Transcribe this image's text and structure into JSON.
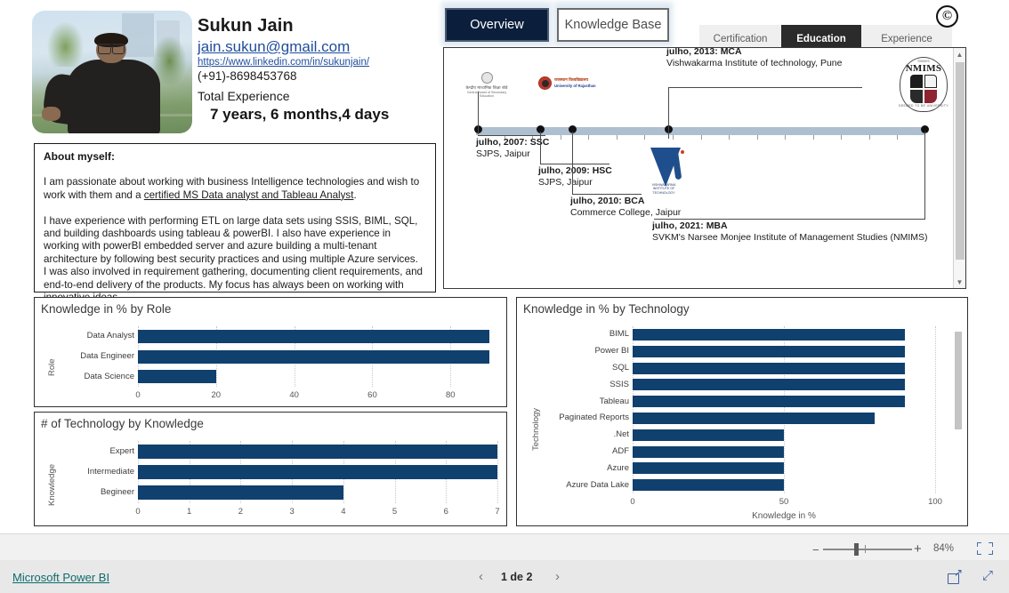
{
  "profile": {
    "name": "Sukun Jain",
    "email": "jain.sukun@gmail.com",
    "linkedin": "https://www.linkedin.com/in/sukunjain/",
    "phone": "(+91)-8698453768",
    "experience_label": "Total Experience",
    "experience_value": "7 years, 6 months,4 days",
    "photo_alt": "profile-photo"
  },
  "about": {
    "title": "About myself:",
    "line1": "I am passionate about working with business Intelligence technologies and wish to work with them and a ",
    "link": "certified MS Data analyst and Tableau Analyst",
    "line1_end": ".",
    "body_rest": "I have experience with performing ETL on large data sets using SSIS, BIML, SQL, and building dashboards using tableau & powerBI. I also have experience in working with powerBI embedded server and azure building a multi-tenant architecture by following best security practices and using multiple Azure services.\nI was also involved in requirement gathering, documenting client requirements, and end-to-end delivery of the products. My focus has always been on working with innovative ideas."
  },
  "main_tabs": [
    {
      "label": "Overview",
      "active": true
    },
    {
      "label": "Knowledge Base",
      "active": false
    }
  ],
  "sub_tabs": [
    {
      "label": "Certification",
      "active": false
    },
    {
      "label": "Education",
      "active": true
    },
    {
      "label": "Experience",
      "active": false
    }
  ],
  "copyright_symbol": "©",
  "timeline": {
    "logos": [
      {
        "name": "cbse-logo",
        "line1": "केन्द्रीय माध्यमिक शिक्षा बोर्ड",
        "line2": "Central Board of Secondary Education"
      },
      {
        "name": "university-of-rajasthan-logo",
        "line1": "राजस्थान विश्वविद्यालय",
        "line2": "University of Rajasthan"
      },
      {
        "name": "vishwakarma-institute-logo",
        "caption": "VISHWAKARMA INSTITUTE OF TECHNOLOGY"
      },
      {
        "name": "nmims-logo",
        "top": "SVKM'S",
        "title": "NMIMS",
        "arc": "DEEMED TO BE UNIVERSITY"
      }
    ],
    "events": [
      {
        "date": "julho, 2007:",
        "degree": "SSC",
        "institute": "SJPS, Jaipur"
      },
      {
        "date": "julho, 2009:",
        "degree": "HSC",
        "institute": "SJPS, Jaipur"
      },
      {
        "date": "julho, 2010:",
        "degree": "BCA",
        "institute": "Commerce College, Jaipur"
      },
      {
        "date": "julho, 2013:",
        "degree": "MCA",
        "institute": "Vishwakarma Institute of technology, Pune"
      },
      {
        "date": "julho, 2021:",
        "degree": "MBA",
        "institute": "SVKM's Narsee Monjee Institute of Management Studies (NMIMS)"
      }
    ]
  },
  "chart_data": [
    {
      "id": "knowledge-by-role",
      "type": "bar",
      "orientation": "horizontal",
      "title": "Knowledge in % by Role",
      "categories": [
        "Data Analyst",
        "Data Engineer",
        "Data Science"
      ],
      "values": [
        90,
        90,
        20
      ],
      "xlabel": "",
      "ylabel": "Role",
      "xlim": [
        0,
        92
      ],
      "xticks": [
        0,
        20,
        40,
        60,
        80
      ],
      "grid": true,
      "bar_color": "#10406e"
    },
    {
      "id": "technology-count-by-knowledge",
      "type": "bar",
      "orientation": "horizontal",
      "title": "# of Technology by Knowledge",
      "categories": [
        "Expert",
        "Intermediate",
        "Begineer"
      ],
      "values": [
        7,
        7,
        4
      ],
      "xlabel": "",
      "ylabel": "Knowledge",
      "xlim": [
        0,
        7
      ],
      "xticks": [
        0,
        1,
        2,
        3,
        4,
        5,
        6,
        7
      ],
      "grid": true,
      "bar_color": "#10406e"
    },
    {
      "id": "knowledge-by-technology",
      "type": "bar",
      "orientation": "horizontal",
      "title": "Knowledge in % by Technology",
      "categories": [
        "BIML",
        "Power BI",
        "SQL",
        "SSIS",
        "Tableau",
        "Paginated Reports",
        ".Net",
        "ADF",
        "Azure",
        "Azure Data Lake"
      ],
      "values": [
        90,
        90,
        90,
        90,
        90,
        80,
        50,
        50,
        50,
        50
      ],
      "xlabel": "Knowledge in %",
      "ylabel": "Technology",
      "xlim": [
        0,
        100
      ],
      "xticks": [
        0,
        50,
        100
      ],
      "grid": true,
      "bar_color": "#10406e"
    }
  ],
  "status_bar": {
    "zoom_out": "−",
    "zoom_in": "+",
    "zoom_value": "84%",
    "fit_to_page": "fit-to-page"
  },
  "footer": {
    "brand": "Microsoft Power BI",
    "prev": "‹",
    "page_indicator": "1 de 2",
    "next": "›",
    "share": "share-icon",
    "fullscreen": "fullscreen-icon"
  }
}
